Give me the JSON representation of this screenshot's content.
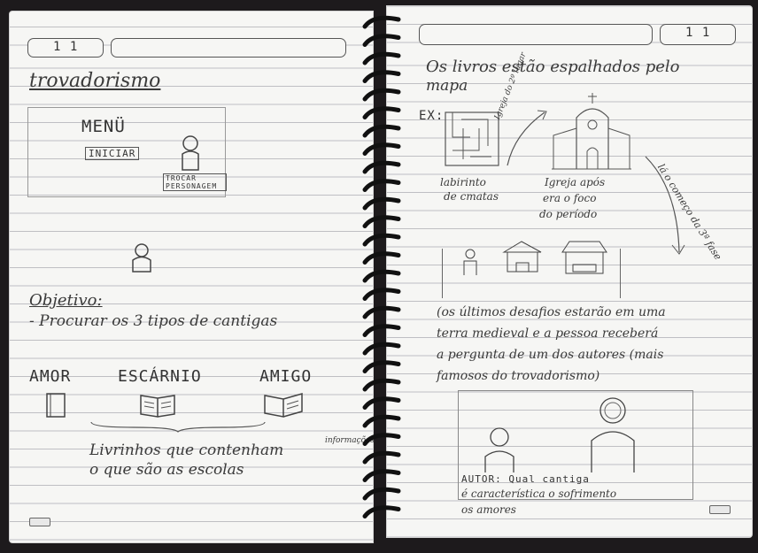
{
  "left_page": {
    "page_number": "1 1",
    "title": "trovadorismo",
    "menu_mockup": {
      "title": "MENÜ",
      "start_button": "INICIAR",
      "change_character_button": "TROCAR PERSONAGEM"
    },
    "objective_label": "Objetivo:",
    "objective_text": "- Procurar os 3 tipos de cantigas",
    "categories": [
      "AMOR",
      "ESCÁRNIO",
      "AMIGO"
    ],
    "books_note": "Livrinhos que contenham",
    "books_note_small": "informações",
    "books_note_line2": "o que são as escolas"
  },
  "right_page": {
    "page_number": "1 1",
    "heading_line1": "Os livros estão espalhados pelo",
    "heading_line2": "mapa",
    "example_label": "EX:",
    "labyrinth_caption_1": "labirinto",
    "labyrinth_caption_2": "de cmatas",
    "path_label": "Igreja do 2º lugar",
    "church_caption_1": "Igreja após",
    "church_caption_2": "era o foco",
    "church_caption_3": "do período",
    "arrow_label": "lá o começo da 3ª fase",
    "final_text_1": "(os últimos desafios estarão em uma",
    "final_text_2": "terra medieval e a pessoa receberá",
    "final_text_3": "a pergunta de um dos autores (mais",
    "final_text_4": "famosos do trovadorismo)",
    "dialog_line1": "AUTOR: Qual cantiga",
    "dialog_line2": "é característica o sofrimento",
    "dialog_line3": "os amores"
  }
}
